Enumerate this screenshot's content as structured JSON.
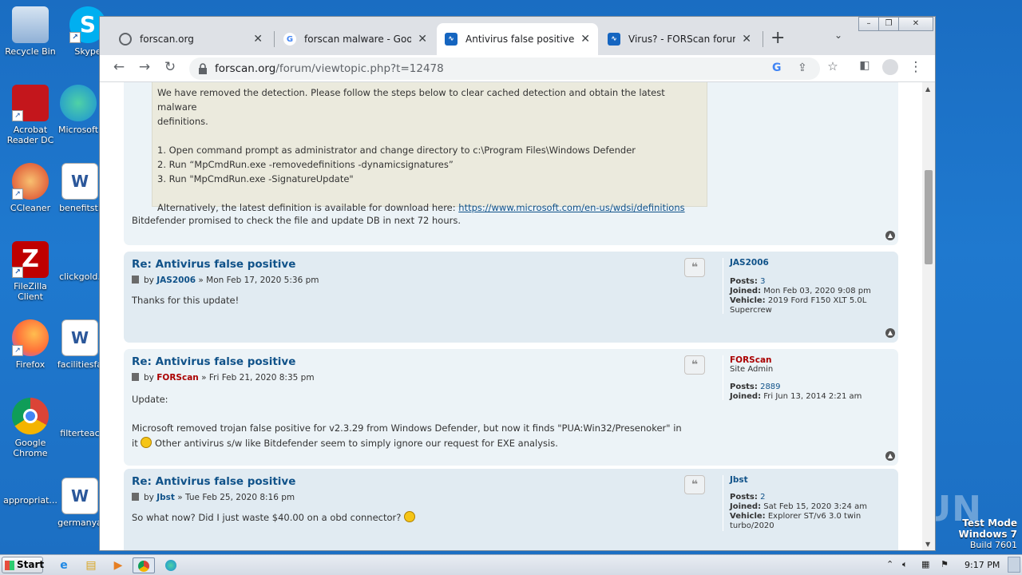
{
  "desktop": {
    "icons": [
      {
        "label": "Recycle Bin",
        "color": "#5b8bc4"
      },
      {
        "label": "Skype",
        "color": "#00aff0"
      },
      {
        "label": "Acrobat Reader DC",
        "color": "#c4161c"
      },
      {
        "label": "Microsoft",
        "color": "#1b8fd6"
      },
      {
        "label": "CCleaner",
        "color": "#d9412a"
      },
      {
        "label": "benefitstl",
        "color": "#2b579a"
      },
      {
        "label": "FileZilla Client",
        "color": "#bf0000"
      },
      {
        "label": "clickgold.",
        "color": "#2a6fbf"
      },
      {
        "label": "Firefox",
        "color": "#ff7139"
      },
      {
        "label": "facilitiesfa",
        "color": "#2b579a"
      },
      {
        "label": "Google Chrome",
        "color": "#4285f4"
      },
      {
        "label": "filterteac",
        "color": "#2a6fbf"
      },
      {
        "label": "appropriat...",
        "color": "#2a6fbf"
      },
      {
        "label": "germanya",
        "color": "#2b579a"
      }
    ],
    "watermark": "ANY RUN",
    "test_mode": {
      "line1": "Test Mode",
      "line2": "Windows 7",
      "line3": "Build 7601"
    }
  },
  "browser": {
    "tabs": [
      {
        "title": "forscan.org",
        "active": false
      },
      {
        "title": "forscan malware - Google Se",
        "active": false
      },
      {
        "title": "Antivirus false positive - FOR",
        "active": true
      },
      {
        "title": "Virus? - FORScan forum",
        "active": false
      }
    ],
    "url_host": "forscan.org",
    "url_path": "/forum/viewtopic.php?t=12478"
  },
  "page": {
    "quote_lines": [
      "We have removed the detection. Please follow the steps below to clear cached detection and obtain the latest malware",
      "definitions.",
      "",
      "1. Open command prompt as administrator and change directory to c:\\Program Files\\Windows Defender",
      "2. Run “MpCmdRun.exe -removedefinitions -dynamicsignatures”",
      "3. Run \"MpCmdRun.exe -SignatureUpdate\"",
      ""
    ],
    "quote_alt_prefix": "Alternatively, the latest definition is available for download here: ",
    "quote_link": "https://www.microsoft.com/en-us/wdsi/definitions",
    "first_post_tail": "Bitdefender promised to check the file and update DB in next 72 hours.",
    "posts": [
      {
        "title": "Re: Antivirus false positive",
        "by": "by",
        "author": "JAS2006",
        "date": "» Mon Feb 17, 2020 5:36 pm",
        "body": "Thanks for this update!",
        "profile": {
          "name": "JAS2006",
          "rank": "",
          "posts_label": "Posts:",
          "posts": "3",
          "joined_label": "Joined:",
          "joined": "Mon Feb 03, 2020 9:08 pm",
          "vehicle_label": "Vehicle:",
          "vehicle": "2019 Ford F150 XLT 5.0L Supercrew"
        }
      },
      {
        "title": "Re: Antivirus false positive",
        "by": "by",
        "author": "FORScan",
        "date": "» Fri Feb 21, 2020 8:35 pm",
        "body_line1": "Update:",
        "body_line2": "Microsoft removed trojan false positive for v2.3.29 from Windows Defender, but now it finds \"PUA:Win32/Presenoker\" in",
        "body_line3_a": "it",
        "body_line3_b": " Other antivirus s/w like Bitdefender seem to simply ignore our request for EXE analysis.",
        "profile": {
          "name": "FORScan",
          "rank": "Site Admin",
          "posts_label": "Posts:",
          "posts": "2889",
          "joined_label": "Joined:",
          "joined": "Fri Jun 13, 2014 2:21 am"
        }
      },
      {
        "title": "Re: Antivirus false positive",
        "by": "by",
        "author": "Jbst",
        "date": "» Tue Feb 25, 2020 8:16 pm",
        "body": "So what now? Did I just waste $40.00 on a obd connector?",
        "profile": {
          "name": "Jbst",
          "posts_label": "Posts:",
          "posts": "2",
          "joined_label": "Joined:",
          "joined": "Sat Feb 15, 2020 3:24 am",
          "vehicle_label": "Vehicle:",
          "vehicle": "Explorer ST/v6 3.0 twin turbo/2020"
        }
      }
    ]
  },
  "taskbar": {
    "start_label": "Start",
    "clock": "9:17 PM"
  }
}
